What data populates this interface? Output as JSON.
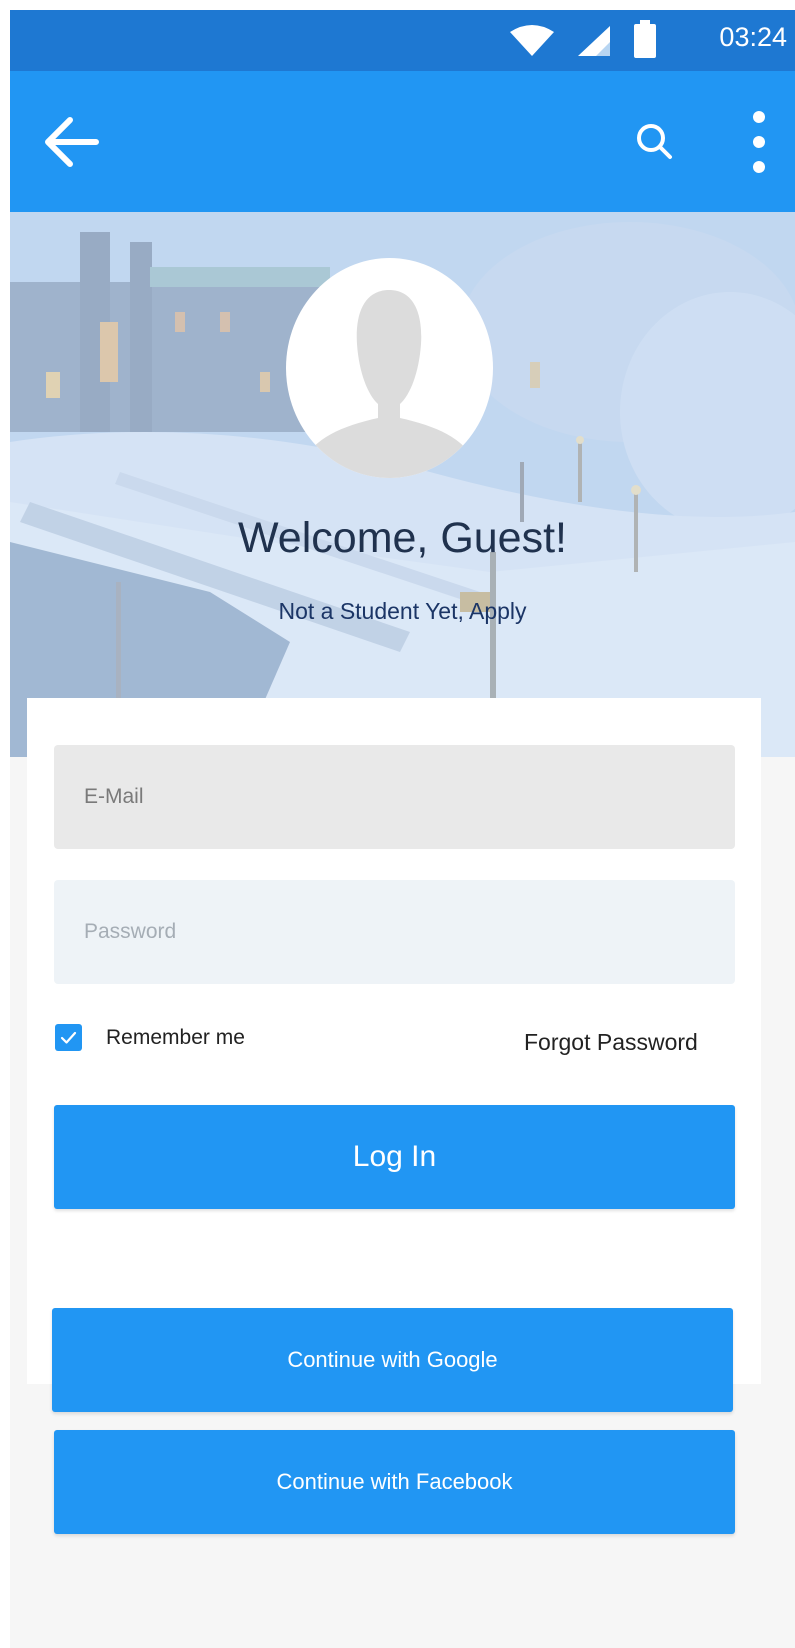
{
  "status_bar": {
    "time": "03:24",
    "icons": [
      "wifi-icon",
      "cell-signal-icon",
      "battery-icon"
    ]
  },
  "app_bar": {
    "back_icon": "arrow-left-icon",
    "search_icon": "search-icon",
    "more_icon": "more-vertical-icon"
  },
  "hero": {
    "welcome": "Welcome, Guest!",
    "apply_link": "Not a Student Yet, Apply",
    "avatar_icon": "person-silhouette-icon"
  },
  "login_form": {
    "email": {
      "placeholder": "E-Mail",
      "value": ""
    },
    "password": {
      "placeholder": "Password",
      "value": ""
    },
    "remember_me": {
      "label": "Remember me",
      "checked": true
    },
    "forgot_password": "Forgot Password",
    "login_button": "Log In"
  },
  "social": {
    "google_button": "Continue with Google",
    "facebook_button": "Continue with Facebook"
  },
  "colors": {
    "status_bar": "#1e78d2",
    "app_bar": "#2196f3",
    "primary_button": "#2196f3",
    "background": "#f6f6f6"
  }
}
